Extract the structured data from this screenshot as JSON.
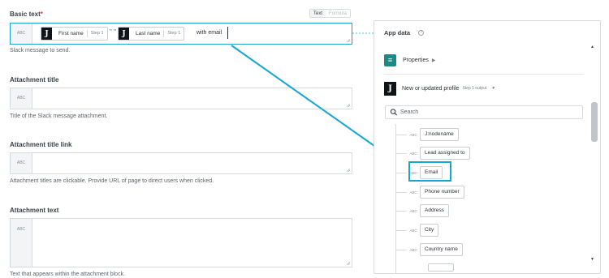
{
  "form": {
    "basic_text": {
      "label": "Basic text",
      "required_mark": "*",
      "toggle": {
        "text": "Text",
        "formula": "Formula"
      },
      "abc": "ABC",
      "pills": [
        {
          "icon": "J",
          "label": "First name",
          "step": "Step 1"
        },
        {
          "icon": "J",
          "label": "Last name",
          "step": "Step 1"
        }
      ],
      "separator": "\" \"",
      "trailing_text": "with email",
      "help": "Slack message to send."
    },
    "attachment_title": {
      "label": "Attachment title",
      "abc": "ABC",
      "help": "Title of the Slack message attachment."
    },
    "attachment_title_link": {
      "label": "Attachment title link",
      "abc": "ABC",
      "help": "Attachment titles are clickable. Provide URL of page to direct users when clicked."
    },
    "attachment_text": {
      "label": "Attachment text",
      "abc": "ABC",
      "help": "Text that appears within the attachment block."
    }
  },
  "panel": {
    "title": "App data",
    "help_icon": "?",
    "properties_label": "Properties",
    "properties_arrow": "▶",
    "source": {
      "icon": "J",
      "label": "New or updated profile",
      "sub": "Step 1 output",
      "dropdown": "▼"
    },
    "search": {
      "placeholder": "Search",
      "value": ""
    },
    "items": [
      {
        "abc": "ABC",
        "label": "J:nodename"
      },
      {
        "abc": "ABC",
        "label": "Lead assigned to"
      },
      {
        "abc": "ABC",
        "label": "Email"
      },
      {
        "abc": "ABC",
        "label": "Phone number"
      },
      {
        "abc": "ABC",
        "label": "Address"
      },
      {
        "abc": "ABC",
        "label": "City"
      },
      {
        "abc": "ABC",
        "label": "Country name"
      }
    ],
    "selected_item": "Email"
  },
  "colors": {
    "accent": "#16a6d3",
    "teal": "#1c8a85",
    "required": "#e03b3b"
  }
}
